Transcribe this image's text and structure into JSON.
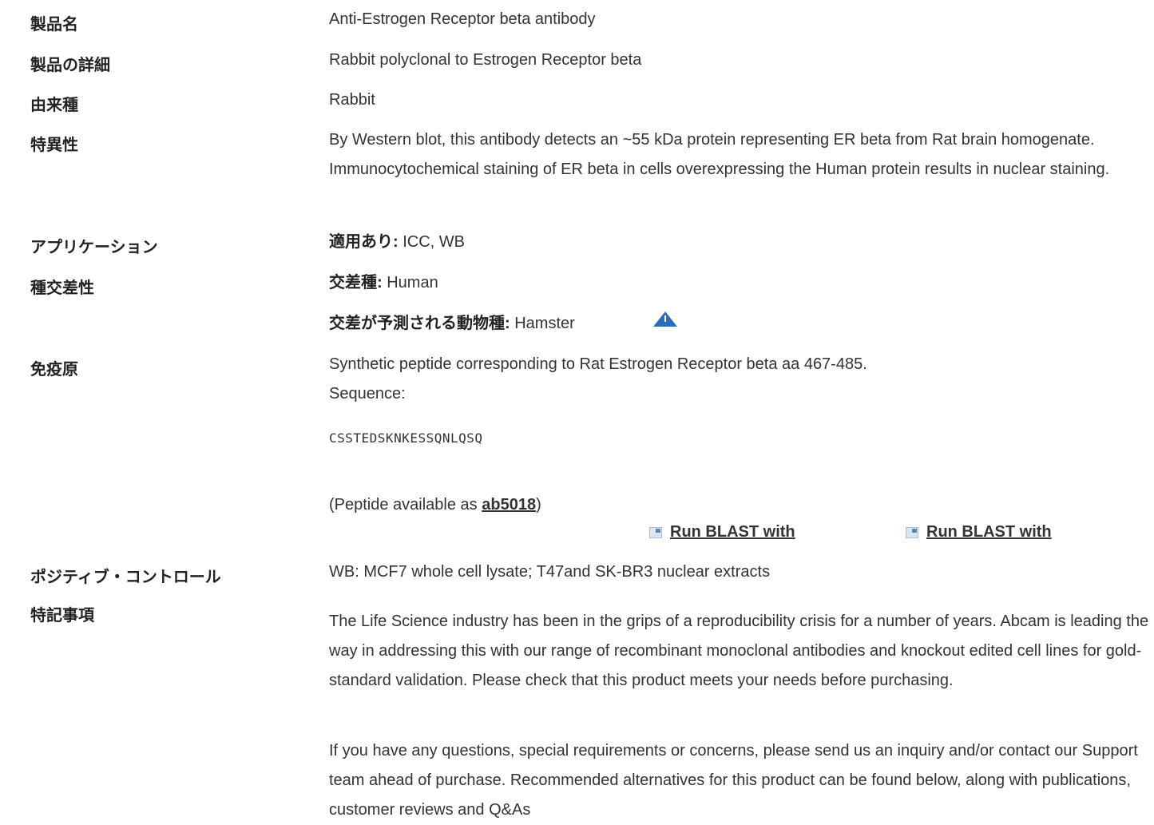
{
  "rows": {
    "product_name": {
      "label": "製品名",
      "value": "Anti-Estrogen Receptor beta antibody"
    },
    "product_detail": {
      "label": "製品の詳細",
      "value": "Rabbit polyclonal to Estrogen Receptor beta"
    },
    "host": {
      "label": "由来種",
      "value": "Rabbit"
    },
    "specificity": {
      "label": "特異性",
      "value": "By Western blot, this antibody detects an ~55 kDa protein representing ER beta from Rat brain homogenate. Immunocytochemical staining of ER beta in cells overexpressing the Human protein results in nuclear staining."
    },
    "applications": {
      "label": "アプリケーション",
      "prefix": "適用あり:",
      "value": " ICC, WB"
    },
    "reactivity": {
      "label": "種交差性",
      "prefix": "交差種:",
      "value": " Human",
      "predicted_prefix": "交差が予測される動物種:",
      "predicted_value": " Hamster",
      "warning_icon": "warning-triangle-icon"
    },
    "immunogen": {
      "label": "免疫原",
      "line1": "Synthetic peptide corresponding to Rat Estrogen Receptor beta aa 467-485.",
      "line2": "Sequence:",
      "sequence": "CSSTEDSKNKESSQNLQSQ",
      "peptide_pre": "(Peptide available as ",
      "peptide_link": "ab5018",
      "peptide_post": ")",
      "blast1": "Run BLAST with",
      "blast2": "Run BLAST with"
    },
    "positive_control": {
      "label": "ポジティブ・コントロール",
      "value": "WB: MCF7 whole cell lysate; T47and SK-BR3 nuclear extracts"
    },
    "notes": {
      "label": "特記事項",
      "p1": "The Life Science industry has been in the grips of a reproducibility crisis for a number of years. Abcam is leading the way in addressing this with our range of recombinant monoclonal antibodies and knockout edited cell lines for gold-standard validation. Please check that this product meets your needs before purchasing.",
      "p2": "If you have any questions, special requirements or concerns, please send us an inquiry and/or contact our Support team ahead of purchase. Recommended alternatives for this product can be found below, along with publications, customer reviews and Q&As"
    }
  },
  "colors": {
    "text": "#333333",
    "label": "#222222",
    "icon_blue": "#2a6fb5"
  }
}
